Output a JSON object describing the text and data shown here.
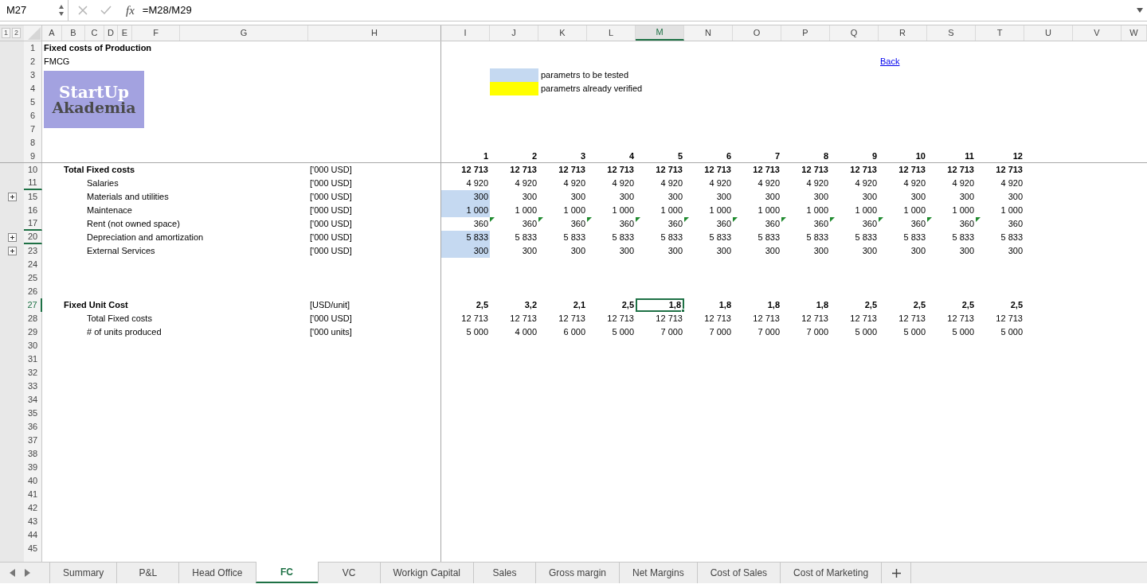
{
  "formula_bar": {
    "name_box": "M27",
    "function_label": "fx",
    "formula": "=M28/M29"
  },
  "outline_levels": [
    "1",
    "2"
  ],
  "columns": [
    {
      "label": "A",
      "selected": false
    },
    {
      "label": "B",
      "selected": false
    },
    {
      "label": "C",
      "selected": false
    },
    {
      "label": "D",
      "selected": false
    },
    {
      "label": "E",
      "selected": false
    },
    {
      "label": "F",
      "selected": false
    },
    {
      "label": "G",
      "selected": false
    },
    {
      "label": "H",
      "selected": false
    },
    {
      "label": "I",
      "selected": false
    },
    {
      "label": "J",
      "selected": false
    },
    {
      "label": "K",
      "selected": false
    },
    {
      "label": "L",
      "selected": false
    },
    {
      "label": "M",
      "selected": true
    },
    {
      "label": "N",
      "selected": false
    },
    {
      "label": "O",
      "selected": false
    },
    {
      "label": "P",
      "selected": false
    },
    {
      "label": "Q",
      "selected": false
    },
    {
      "label": "R",
      "selected": false
    },
    {
      "label": "S",
      "selected": false
    },
    {
      "label": "T",
      "selected": false
    },
    {
      "label": "U",
      "selected": false
    },
    {
      "label": "V",
      "selected": false
    },
    {
      "label": "W",
      "selected": false
    }
  ],
  "logo": {
    "lines": [
      "StartUp",
      "Akademia"
    ]
  },
  "rows": [
    {
      "number": "1",
      "selected": false,
      "expand_button": false,
      "hidden_below": false,
      "kind": "title",
      "label": "Fixed costs of Production"
    },
    {
      "number": "2",
      "selected": false,
      "expand_button": false,
      "hidden_below": false,
      "kind": "text",
      "label": "FMCG",
      "link": "Back"
    },
    {
      "number": "3",
      "selected": false,
      "expand_button": false,
      "hidden_below": false,
      "kind": "legend",
      "label": "parametrs to be tested",
      "color": "#c5d9f1"
    },
    {
      "number": "4",
      "selected": false,
      "expand_button": false,
      "hidden_below": false,
      "kind": "legend",
      "label": "parametrs already verified",
      "color": "#ffff00"
    },
    {
      "number": "5",
      "selected": false,
      "expand_button": false,
      "hidden_below": false,
      "kind": "empty"
    },
    {
      "number": "6",
      "selected": false,
      "expand_button": false,
      "hidden_below": false,
      "kind": "empty"
    },
    {
      "number": "7",
      "selected": false,
      "expand_button": false,
      "hidden_below": false,
      "kind": "empty"
    },
    {
      "number": "8",
      "selected": false,
      "expand_button": false,
      "hidden_below": false,
      "kind": "empty"
    },
    {
      "number": "9",
      "selected": false,
      "expand_button": false,
      "hidden_below": false,
      "kind": "periods",
      "values": [
        "1",
        "2",
        "3",
        "4",
        "5",
        "6",
        "7",
        "8",
        "9",
        "10",
        "11",
        "12"
      ]
    },
    {
      "number": "10",
      "selected": false,
      "expand_button": false,
      "hidden_below": false,
      "kind": "total",
      "label": "Total Fixed costs",
      "unit": "['000 USD]",
      "values": [
        "12 713",
        "12 713",
        "12 713",
        "12 713",
        "12 713",
        "12 713",
        "12 713",
        "12 713",
        "12 713",
        "12 713",
        "12 713",
        "12 713"
      ]
    },
    {
      "number": "11",
      "selected": false,
      "expand_button": false,
      "hidden_below": true,
      "kind": "item",
      "label": "Salaries",
      "unit": "['000 USD]",
      "values": [
        "4 920",
        "4 920",
        "4 920",
        "4 920",
        "4 920",
        "4 920",
        "4 920",
        "4 920",
        "4 920",
        "4 920",
        "4 920",
        "4 920"
      ]
    },
    {
      "number": "15",
      "selected": false,
      "expand_button": true,
      "hidden_below": false,
      "kind": "item",
      "label": "Materials and utilities",
      "unit": "['000 USD]",
      "first_cell": {
        "color": "#c5d9f1"
      },
      "values": [
        "300",
        "300",
        "300",
        "300",
        "300",
        "300",
        "300",
        "300",
        "300",
        "300",
        "300",
        "300"
      ]
    },
    {
      "number": "16",
      "selected": false,
      "expand_button": false,
      "hidden_below": false,
      "kind": "item",
      "label": "Maintenace",
      "unit": "['000 USD]",
      "first_cell": {
        "color": "#c5d9f1"
      },
      "values": [
        "1 000",
        "1 000",
        "1 000",
        "1 000",
        "1 000",
        "1 000",
        "1 000",
        "1 000",
        "1 000",
        "1 000",
        "1 000",
        "1 000"
      ]
    },
    {
      "number": "17",
      "selected": false,
      "expand_button": false,
      "hidden_below": true,
      "kind": "item",
      "label": "Rent (not owned space)",
      "unit": "['000 USD]",
      "values": [
        "360",
        "360",
        "360",
        "360",
        "360",
        "360",
        "360",
        "360",
        "360",
        "360",
        "360",
        "360"
      ],
      "flags": [
        false,
        true,
        true,
        true,
        true,
        true,
        true,
        true,
        true,
        true,
        true,
        true
      ]
    },
    {
      "number": "20",
      "selected": false,
      "expand_button": true,
      "hidden_below": true,
      "kind": "item",
      "label": "Depreciation and amortization",
      "unit": "['000 USD]",
      "first_cell": {
        "color": "#c5d9f1"
      },
      "values": [
        "5 833",
        "5 833",
        "5 833",
        "5 833",
        "5 833",
        "5 833",
        "5 833",
        "5 833",
        "5 833",
        "5 833",
        "5 833",
        "5 833"
      ]
    },
    {
      "number": "23",
      "selected": false,
      "expand_button": true,
      "hidden_below": false,
      "kind": "item",
      "label": "External Services",
      "unit": "['000 USD]",
      "first_cell": {
        "color": "#c5d9f1"
      },
      "values": [
        "300",
        "300",
        "300",
        "300",
        "300",
        "300",
        "300",
        "300",
        "300",
        "300",
        "300",
        "300"
      ]
    },
    {
      "number": "24",
      "selected": false,
      "expand_button": false,
      "hidden_below": false,
      "kind": "empty"
    },
    {
      "number": "25",
      "selected": false,
      "expand_button": false,
      "hidden_below": false,
      "kind": "empty"
    },
    {
      "number": "26",
      "selected": false,
      "expand_button": false,
      "hidden_below": false,
      "kind": "empty"
    },
    {
      "number": "27",
      "selected": true,
      "expand_button": false,
      "hidden_below": false,
      "kind": "total",
      "label": "Fixed Unit Cost",
      "unit": "[USD/unit]",
      "values": [
        "2,5",
        "3,2",
        "2,1",
        "2,5",
        "1,8",
        "1,8",
        "1,8",
        "1,8",
        "2,5",
        "2,5",
        "2,5",
        "2,5"
      ]
    },
    {
      "number": "28",
      "selected": false,
      "expand_button": false,
      "hidden_below": false,
      "kind": "item",
      "label": "Total Fixed costs",
      "unit": "['000 USD]",
      "values": [
        "12 713",
        "12 713",
        "12 713",
        "12 713",
        "12 713",
        "12 713",
        "12 713",
        "12 713",
        "12 713",
        "12 713",
        "12 713",
        "12 713"
      ]
    },
    {
      "number": "29",
      "selected": false,
      "expand_button": false,
      "hidden_below": false,
      "kind": "item",
      "label": "# of units produced",
      "unit": "['000 units]",
      "values": [
        "5 000",
        "4 000",
        "6 000",
        "5 000",
        "7 000",
        "7 000",
        "7 000",
        "7 000",
        "5 000",
        "5 000",
        "5 000",
        "5 000"
      ]
    },
    {
      "number": "30",
      "selected": false,
      "expand_button": false,
      "hidden_below": false,
      "kind": "empty"
    },
    {
      "number": "31",
      "selected": false,
      "expand_button": false,
      "hidden_below": false,
      "kind": "empty"
    },
    {
      "number": "32",
      "selected": false,
      "expand_button": false,
      "hidden_below": false,
      "kind": "empty"
    },
    {
      "number": "33",
      "selected": false,
      "expand_button": false,
      "hidden_below": false,
      "kind": "empty"
    },
    {
      "number": "34",
      "selected": false,
      "expand_button": false,
      "hidden_below": false,
      "kind": "empty"
    },
    {
      "number": "35",
      "selected": false,
      "expand_button": false,
      "hidden_below": false,
      "kind": "empty"
    },
    {
      "number": "36",
      "selected": false,
      "expand_button": false,
      "hidden_below": false,
      "kind": "empty"
    },
    {
      "number": "37",
      "selected": false,
      "expand_button": false,
      "hidden_below": false,
      "kind": "empty"
    },
    {
      "number": "38",
      "selected": false,
      "expand_button": false,
      "hidden_below": false,
      "kind": "empty"
    },
    {
      "number": "39",
      "selected": false,
      "expand_button": false,
      "hidden_below": false,
      "kind": "empty"
    },
    {
      "number": "40",
      "selected": false,
      "expand_button": false,
      "hidden_below": false,
      "kind": "empty"
    },
    {
      "number": "41",
      "selected": false,
      "expand_button": false,
      "hidden_below": false,
      "kind": "empty"
    },
    {
      "number": "42",
      "selected": false,
      "expand_button": false,
      "hidden_below": false,
      "kind": "empty"
    },
    {
      "number": "43",
      "selected": false,
      "expand_button": false,
      "hidden_below": false,
      "kind": "empty"
    },
    {
      "number": "44",
      "selected": false,
      "expand_button": false,
      "hidden_below": false,
      "kind": "empty"
    },
    {
      "number": "45",
      "selected": false,
      "expand_button": false,
      "hidden_below": false,
      "kind": "empty"
    }
  ],
  "sheet_tabs": [
    {
      "label": "Summary",
      "selected": false
    },
    {
      "label": "P&L",
      "selected": false
    },
    {
      "label": "Head Office",
      "selected": false
    },
    {
      "label": "FC",
      "selected": true
    },
    {
      "label": "VC",
      "selected": false
    },
    {
      "label": "Workign Capital",
      "selected": false
    },
    {
      "label": "Sales",
      "selected": false
    },
    {
      "label": "Gross margin",
      "selected": false
    },
    {
      "label": "Net Margins",
      "selected": false
    },
    {
      "label": "Cost of Sales",
      "selected": false
    },
    {
      "label": "Cost of Marketing",
      "selected": false
    }
  ]
}
